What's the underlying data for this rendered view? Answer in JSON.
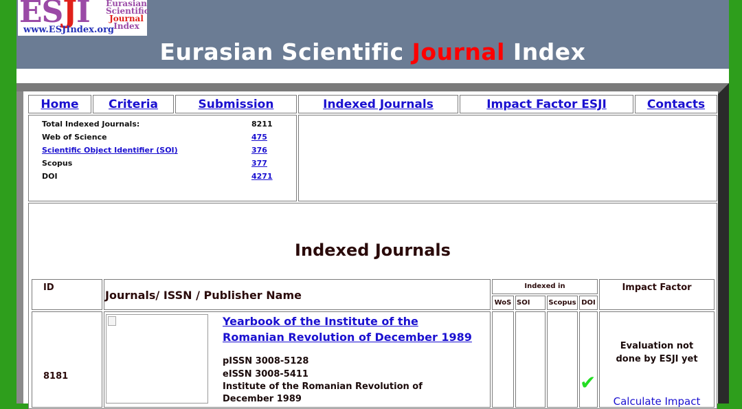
{
  "logo": {
    "main_prefix": "ES",
    "main_accent": "J",
    "main_suffix": "I",
    "side_line1": "Eurasian",
    "side_line2": "Scientific",
    "side_line3": "Journal",
    "side_line4": "Index",
    "url": "www.ESJIndex.org"
  },
  "site_title": {
    "part1": "Eurasian Scientific ",
    "accent": "Journal",
    "part2": " Index"
  },
  "nav": {
    "home": "Home",
    "criteria": "Criteria",
    "submission": "Submission",
    "indexed_journals": "Indexed Journals",
    "impact_factor": "Impact Factor ESJI",
    "contacts": "Contacts"
  },
  "stats": [
    {
      "label": "Total Indexed Journals:",
      "value": "8211",
      "label_link": false,
      "value_link": false
    },
    {
      "label": "Web of Science",
      "value": "475",
      "label_link": false,
      "value_link": true
    },
    {
      "label": "Scientific Object Identifier (SOI)",
      "value": "376",
      "label_link": true,
      "value_link": true
    },
    {
      "label": "Scopus",
      "value": "377",
      "label_link": false,
      "value_link": true
    },
    {
      "label": "DOI",
      "value": "4271",
      "label_link": false,
      "value_link": true
    }
  ],
  "section_title": "Indexed Journals",
  "table": {
    "headers": {
      "id": "ID",
      "journal": "Journals/ ISSN / Publisher Name",
      "indexed_in": "Indexed in",
      "wos": "WoS",
      "soi": "SOI",
      "scopus": "Scopus",
      "doi": "DOI",
      "impact_factor": "Impact Factor"
    },
    "rows": [
      {
        "id": "8181",
        "title_line1": "Yearbook of the Institute of the",
        "title_line2": "Romanian Revolution of December 1989",
        "pissn": "pISSN 3008-5128",
        "eissn": "eISSN 3008-5411",
        "publisher_line1": "Institute of the Romanian Revolution of",
        "publisher_line2": "December 1989",
        "doi_check": "✔",
        "evaluation_line1": "Evaluation not",
        "evaluation_line2": "done by ESJI yet",
        "calc_link": "Calculate Impact"
      }
    ]
  },
  "colors": {
    "page_bg": "#2e9e1c",
    "header_bg": "#6b7c94",
    "link": "#1a10d0",
    "accent_red": "#ff0000",
    "check_green": "#22dd22"
  }
}
